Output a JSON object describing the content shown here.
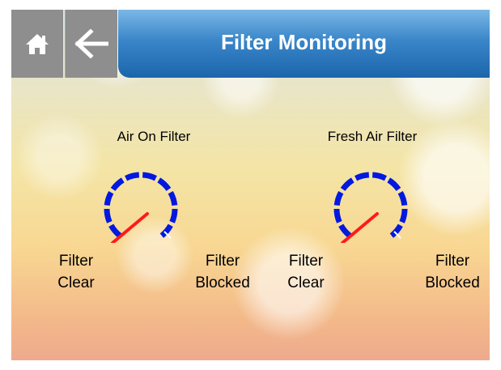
{
  "header": {
    "title": "Filter Monitoring",
    "home_icon": "home-icon",
    "back_icon": "arrow-left-icon",
    "nav_color": "#8e8e8e",
    "title_color": "#2f7fc4"
  },
  "gauges": [
    {
      "title": "Air On Filter",
      "min_label": "Filter\nClear",
      "max_label": "Filter\nBlocked",
      "needle_level": 0.0
    },
    {
      "title": "Fresh Air Filter",
      "min_label": "Filter\nClear",
      "max_label": "Filter\nBlocked",
      "needle_level": 0.0
    }
  ],
  "colors": {
    "scale": "#0018e0",
    "needle": "#ff1a1a"
  }
}
